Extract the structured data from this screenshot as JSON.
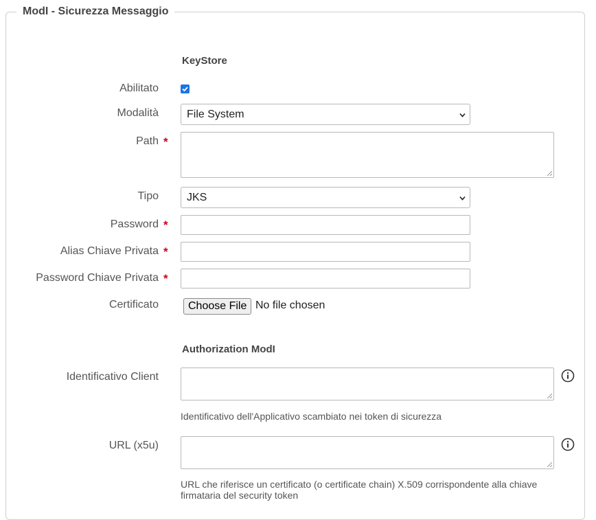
{
  "legend": "ModI - Sicurezza Messaggio",
  "keystore": {
    "title": "KeyStore",
    "abilitato_label": "Abilitato",
    "abilitato_checked": true,
    "modalita_label": "Modalità",
    "modalita_value": "File System",
    "path_label": "Path",
    "tipo_label": "Tipo",
    "tipo_value": "JKS",
    "password_label": "Password",
    "alias_label": "Alias Chiave Privata",
    "password_chiave_label": "Password Chiave Privata",
    "certificato_label": "Certificato",
    "choose_file_label": "Choose File",
    "no_file_label": "No file chosen",
    "required_mark": "*"
  },
  "authorization": {
    "title": "Authorization ModI",
    "client_label": "Identificativo Client",
    "client_help": "Identificativo dell'Applicativo scambiato nei token di sicurezza",
    "url_label": "URL (x5u)",
    "url_help": "URL che riferisce un certificato (o certificate chain) X.509 corrispondente alla chiave firmataria del security token"
  },
  "icons": {
    "info": "info-circle-icon",
    "dropdown": "chevron-down-icon",
    "check": "checkmark-icon"
  },
  "colors": {
    "required": "#d0021b",
    "checkbox": "#1a73e8",
    "border": "#cfcfcf"
  }
}
